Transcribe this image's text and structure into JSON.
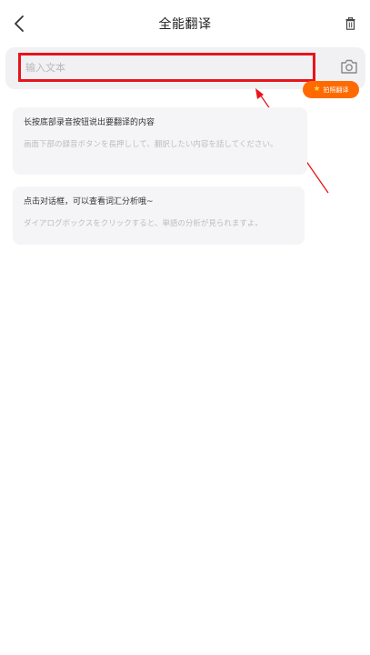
{
  "header": {
    "title": "全能翻译",
    "back_icon": "chevron-left-icon",
    "trash_icon": "trash-icon"
  },
  "input": {
    "placeholder": "输入文本",
    "value": "",
    "camera_icon": "camera-icon"
  },
  "badge": {
    "icon": "star-icon",
    "label": "拍照翻译"
  },
  "hints": [
    {
      "zh": "长按底部录音按钮说出要翻译的内容",
      "ja": "画面下部の録音ボタンを長押しして、翻訳したい内容を話してください。"
    },
    {
      "zh": "点击对话框，可以查看词汇分析哦~",
      "ja": "ダイアログボックスをクリックすると、単語の分析が見られますよ。"
    }
  ],
  "colors": {
    "highlight_border": "#e8141b",
    "badge_bg": "#ff6a00",
    "input_bg": "#f1f1f3",
    "bubble_bg": "#f5f5f7"
  }
}
